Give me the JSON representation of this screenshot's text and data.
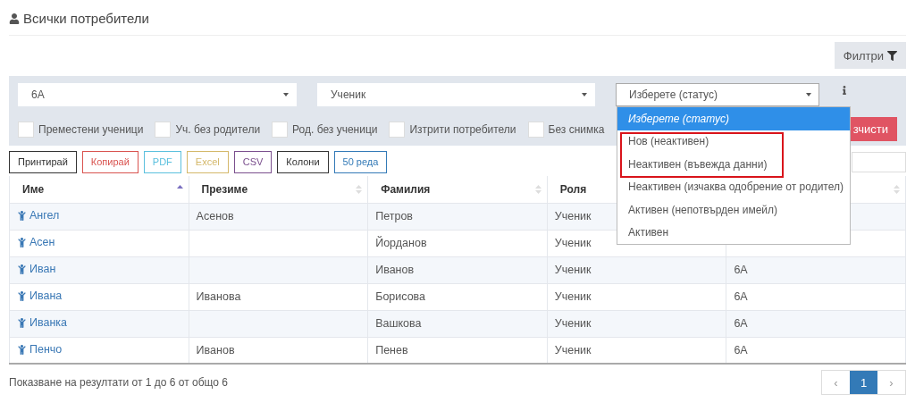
{
  "page_title": "Всички потребители",
  "filters_button": "Филтри",
  "filters": {
    "selects": [
      {
        "value": "6А"
      },
      {
        "value": "Ученик"
      },
      {
        "value": "Изберете (статус)",
        "open": true
      }
    ],
    "checkboxes": [
      {
        "label": "Преместени ученици",
        "checked": false
      },
      {
        "label": "Уч. без родители",
        "checked": false
      },
      {
        "label": "Род. без ученици",
        "checked": false
      },
      {
        "label": "Изтрити потребители",
        "checked": false
      },
      {
        "label": "Без снимка",
        "checked": false
      }
    ],
    "clear_button": "зчисти"
  },
  "status_options": [
    {
      "label": "Изберете (статус)",
      "selected": true,
      "highlighted": false
    },
    {
      "label": "Нов (неактивен)",
      "selected": false,
      "highlighted": true
    },
    {
      "label": "Неактивен (въвежда данни)",
      "selected": false,
      "highlighted": true
    },
    {
      "label": "Неактивен (изчаква одобрение от родител)",
      "selected": false,
      "highlighted": false
    },
    {
      "label": "Активен (непотвърден имейл)",
      "selected": false,
      "highlighted": false
    },
    {
      "label": "Активен",
      "selected": false,
      "highlighted": false
    }
  ],
  "export_buttons": [
    {
      "label": "Принтирай",
      "color": "#333333"
    },
    {
      "label": "Копирай",
      "color": "#d9534f"
    },
    {
      "label": "PDF",
      "color": "#5bc0de"
    },
    {
      "label": "Excel",
      "color": "#d4b86a"
    },
    {
      "label": "CSV",
      "color": "#7b4f8e"
    },
    {
      "label": "Колони",
      "color": "#333333"
    },
    {
      "label": "50 реда",
      "color": "#337ab7"
    }
  ],
  "table": {
    "columns": [
      {
        "label": "Име",
        "sorted": true
      },
      {
        "label": "Презиме",
        "sorted": false
      },
      {
        "label": "Фамилия",
        "sorted": false
      },
      {
        "label": "Роля"
      },
      {
        "sorted": false
      }
    ],
    "rows": [
      {
        "first": "Ангел",
        "middle": "Асенов",
        "last": "Петров",
        "role": "Ученик"
      },
      {
        "first": "Асен",
        "last": "Йорданов",
        "role": "Ученик"
      },
      {
        "first": "Иван",
        "last": "Иванов",
        "role": "Ученик",
        "class": "6А"
      },
      {
        "first": "Ивана",
        "middle": "Иванова",
        "last": "Борисова",
        "role": "Ученик",
        "class": "6А"
      },
      {
        "first": "Иванка",
        "last": "Вашкова",
        "role": "Ученик",
        "class": "6А"
      },
      {
        "first": "Пенчо",
        "middle": "Иванов",
        "last": "Пенев",
        "role": "Ученик",
        "class": "6А"
      }
    ]
  },
  "summary": "Показване на резултати от 1 до 6 от общо 6",
  "pagination": {
    "prev": "‹",
    "pages": [
      {
        "label": "1",
        "selected": true
      }
    ],
    "next": "›"
  }
}
